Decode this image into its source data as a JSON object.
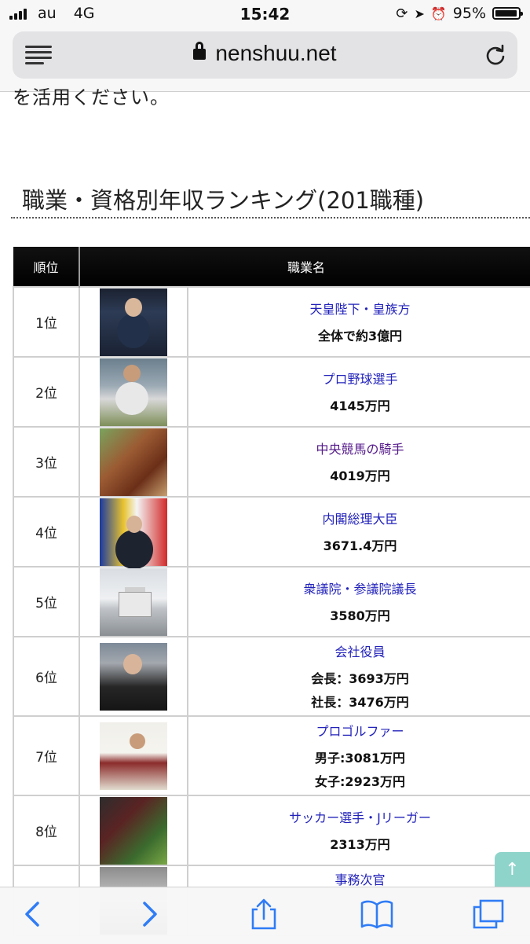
{
  "status_bar": {
    "carrier": "au",
    "network": "4G",
    "time": "15:42",
    "battery": "95%",
    "battery_level": 0.95
  },
  "browser": {
    "url": "nenshuu.net"
  },
  "page": {
    "cut_text": "を活用ください。",
    "section_title": "職業・資格別年収ランキング(201職種)",
    "table": {
      "headers": [
        "順位",
        "職業名"
      ],
      "rows": [
        {
          "rank": "1位",
          "job": "天皇陛下・皇族方",
          "salaries": [
            "全体で約3億円"
          ]
        },
        {
          "rank": "2位",
          "job": "プロ野球選手",
          "salaries": [
            "4145万円"
          ]
        },
        {
          "rank": "3位",
          "job": "中央競馬の騎手",
          "salaries": [
            "4019万円"
          ]
        },
        {
          "rank": "4位",
          "job": "内閣総理大臣",
          "salaries": [
            "3671.4万円"
          ]
        },
        {
          "rank": "5位",
          "job": "衆議院・参議院議長",
          "salaries": [
            "3580万円"
          ]
        },
        {
          "rank": "6位",
          "job": "会社役員",
          "salaries": [
            "会長：3693万円",
            "社長：3476万円"
          ]
        },
        {
          "rank": "7位",
          "job": "プロゴルファー",
          "salaries": [
            "男子:3081万円",
            "女子:2923万円"
          ]
        },
        {
          "rank": "8位",
          "job": "サッカー選手・Jリーガー",
          "salaries": [
            "2313万円"
          ]
        },
        {
          "rank": "",
          "job": "事務次官",
          "salaries": []
        }
      ]
    },
    "to_top_icon": "arrow-up-icon"
  },
  "toolbar": {
    "icons": [
      "back-chevron-icon",
      "forward-chevron-icon",
      "share-icon",
      "bookmarks-icon",
      "tabs-icon"
    ]
  }
}
